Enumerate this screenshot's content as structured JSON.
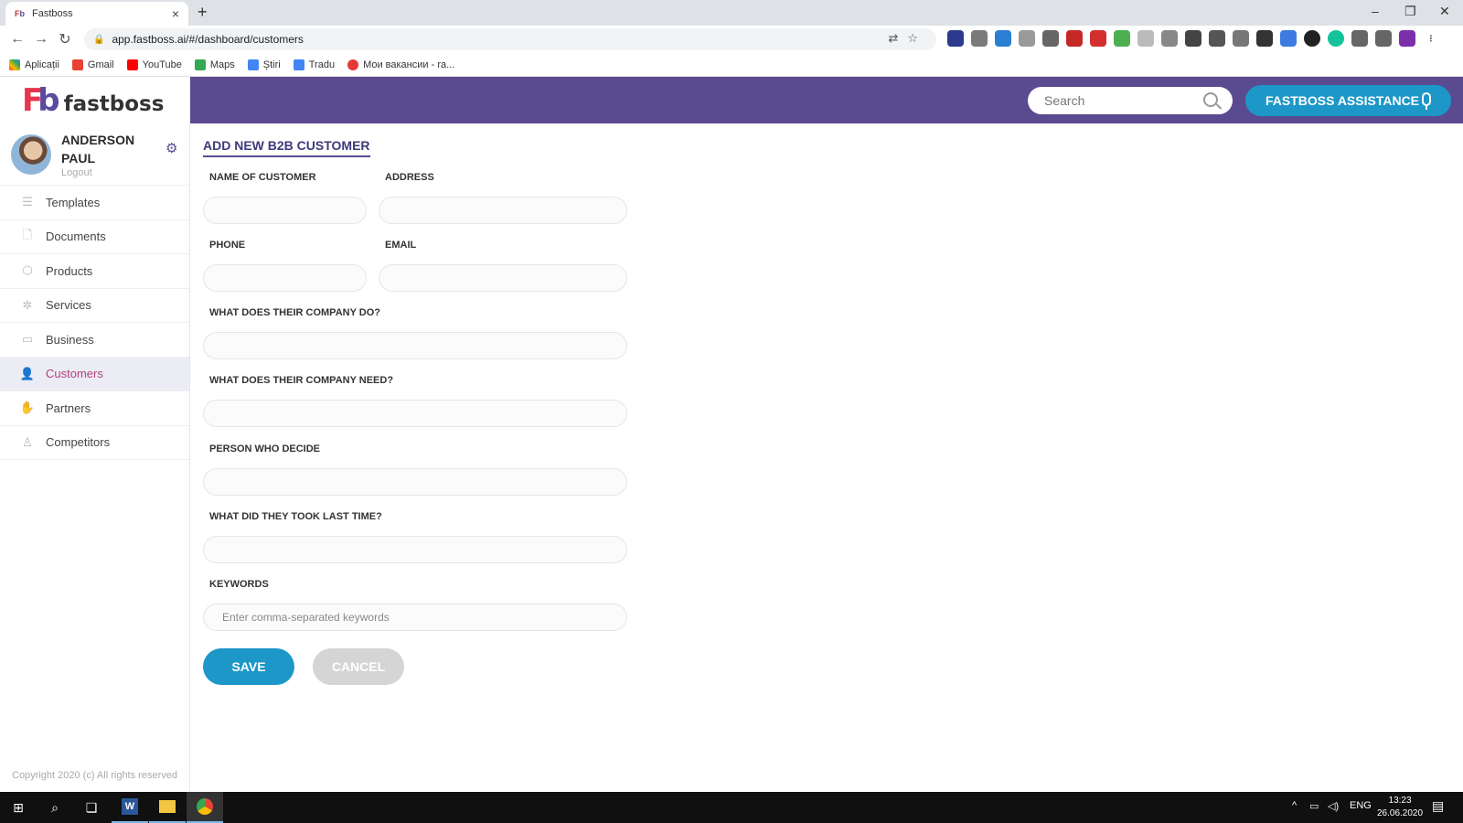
{
  "browser": {
    "tab_title": "Fastboss",
    "url": "app.fastboss.ai/#/dashboard/customers",
    "bookmarks": [
      "Aplicații",
      "Gmail",
      "YouTube",
      "Maps",
      "Știri",
      "Tradu",
      "Мои вакансии - ra..."
    ]
  },
  "header": {
    "logo_mark_a": "F",
    "logo_mark_b": "b",
    "logo_text": "fastboss",
    "search_placeholder": "Search",
    "assist_label": "FASTBOSS ASSISTANCE"
  },
  "user": {
    "name": "ANDERSON PAUL",
    "logout": "Logout"
  },
  "sidebar": {
    "items": [
      {
        "label": "Templates",
        "icon": "template-icon"
      },
      {
        "label": "Documents",
        "icon": "document-icon"
      },
      {
        "label": "Products",
        "icon": "box-icon"
      },
      {
        "label": "Services",
        "icon": "services-icon"
      },
      {
        "label": "Business",
        "icon": "briefcase-icon"
      },
      {
        "label": "Customers",
        "icon": "user-icon",
        "active": true
      },
      {
        "label": "Partners",
        "icon": "handshake-icon"
      },
      {
        "label": "Competitors",
        "icon": "competitors-icon"
      }
    ],
    "copyright": "Copyright 2020 (c) All rights reserved"
  },
  "form": {
    "title": "ADD NEW B2B CUSTOMER",
    "name_label": "NAME OF CUSTOMER",
    "address_label": "ADDRESS",
    "phone_label": "PHONE",
    "email_label": "EMAIL",
    "company_do_label": "WHAT DOES THEIR COMPANY DO?",
    "company_need_label": "WHAT DOES THEIR COMPANY NEED?",
    "decider_label": "PERSON WHO DECIDE",
    "last_time_label": "WHAT DID THEY TOOK LAST TIME?",
    "keywords_label": "KEYWORDS",
    "keywords_placeholder": "Enter comma-separated keywords",
    "save_label": "SAVE",
    "cancel_label": "CANCEL"
  },
  "taskbar": {
    "language": "ENG",
    "time": "13:23",
    "date": "26.06.2020"
  },
  "colors": {
    "topbar": "#5a4a8f",
    "accent": "#1d97c8",
    "active_nav": "#b2417e"
  }
}
